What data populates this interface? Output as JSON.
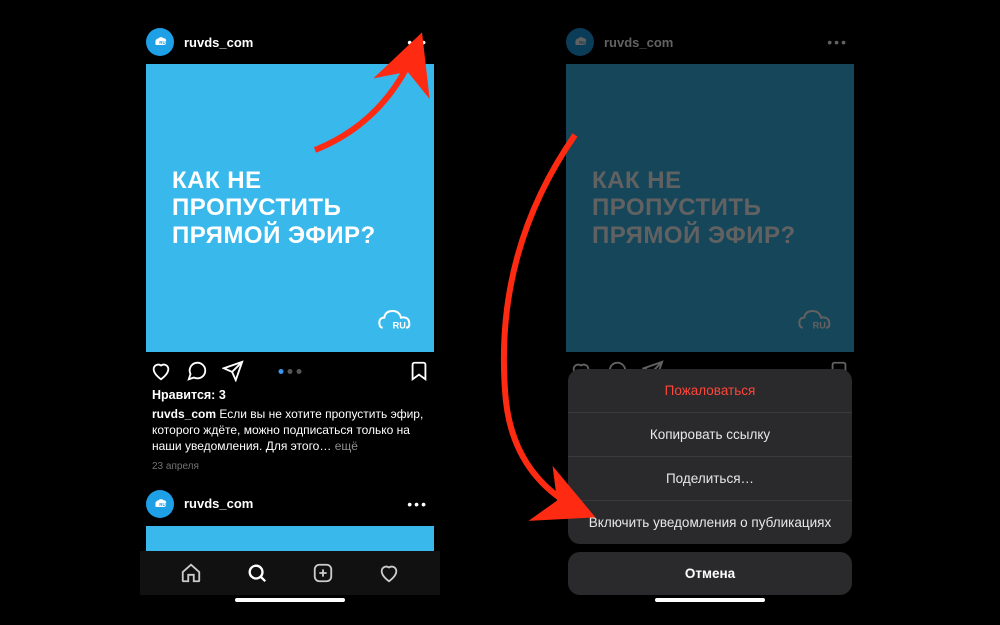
{
  "left": {
    "header": {
      "username": "ruvds_com"
    },
    "post": {
      "headline": "КАК НЕ\nПРОПУСТИТЬ\nПРЯМОЙ ЭФИР?",
      "logo_text": "RU"
    },
    "likes_label": "Нравится: 3",
    "caption": {
      "user": "ruvds_com",
      "text": "Если вы не хотите пропустить эфир, которого ждёте, можно подписаться только на наши уведомления. Для этого…",
      "more": "ещё"
    },
    "date": "23 апреля",
    "second_header_username": "ruvds_com"
  },
  "right": {
    "header": {
      "username": "ruvds_com"
    },
    "post": {
      "headline": "КАК НЕ\nПРОПУСТИТЬ\nПРЯМОЙ ЭФИР?",
      "logo_text": "RU"
    },
    "sheet": {
      "report": "Пожаловаться",
      "copy_link": "Копировать ссылку",
      "share": "Поделиться…",
      "notifications": "Включить уведомления о публикациях",
      "cancel": "Отмена"
    }
  },
  "colors": {
    "brand": "#38b8eb",
    "arrow": "#ff2a12"
  }
}
